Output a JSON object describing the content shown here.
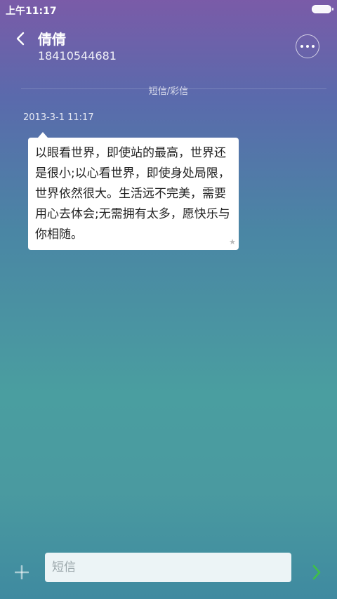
{
  "status_bar": {
    "time": "上午11:17",
    "battery_icon": "battery-icon"
  },
  "header": {
    "back_icon": "chevron-left-icon",
    "contact_name": "倩倩",
    "phone_number": "18410544681",
    "more_icon": "more-dots-icon"
  },
  "thread": {
    "channel_label": "短信/彩信",
    "messages": [
      {
        "timestamp": "2013-3-1 11:17",
        "text": "以眼看世界，即使站的最高，世界还是很小;以心看世界，即使身处局限，世界依然很大。生活远不完美，需要用心去体会;无需拥有太多，愿快乐与你相随。",
        "star_icon": "star-icon"
      }
    ]
  },
  "composer": {
    "add_icon": "plus-icon",
    "input_value": "",
    "input_placeholder": "短信",
    "send_icon": "send-arrow-icon"
  },
  "colors": {
    "accent_send": "#3fbf4a",
    "bubble_bg": "#ffffff"
  }
}
